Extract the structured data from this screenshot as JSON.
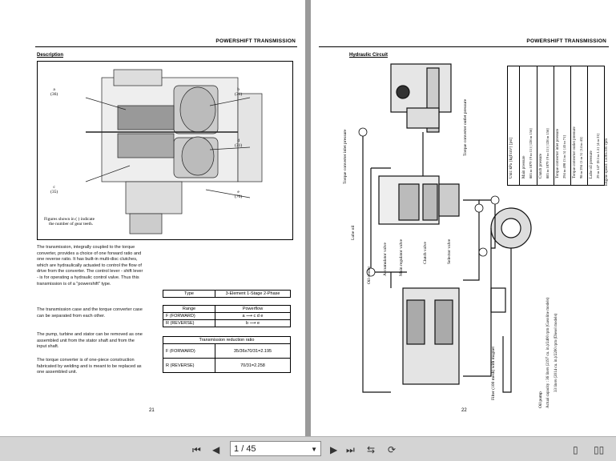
{
  "viewer": {
    "pagination": {
      "current": "1",
      "separator": "/",
      "total": "45"
    }
  },
  "left_page": {
    "header": "POWERSHIFT TRANSMISSION",
    "section": "Description",
    "callouts": [
      {
        "letter": "a",
        "teeth": "(36)"
      },
      {
        "letter": "b",
        "teeth": "(31)"
      },
      {
        "letter": "d",
        "teeth": "(31)"
      },
      {
        "letter": "c",
        "teeth": "(35)"
      },
      {
        "letter": "e",
        "teeth": "(70)"
      }
    ],
    "figure_note_1": "Figures shown in ( ) indicate",
    "figure_note_2": "the number of gear teeth.",
    "paragraphs": [
      " The transmission, integrally coupled to the torque converter, provides a choice of one forward ratio and one reverse ratio. It has built-in multi-disc clutches, which are hydraulically actuated to control the flow of drive from the converter. The control lever - shift lever - is for operating a hydraulic control valve. Thus this transmission is of a \"powershift\" type.",
      " The transmission case and the torque converter case can be separated from each other.",
      " The pump, turbine and stator can be removed as one assembled unit from the stator shaft and from the input shaft.",
      " The torque converter is of one-piece construction fabricated by welding and is meant to be replaced as one assembled unit."
    ],
    "type_table": {
      "label": "Type",
      "value": "3-Element 1-Stage 2-Phase"
    },
    "range_table": {
      "headers": [
        "Range",
        "Powerflow"
      ],
      "rows": [
        {
          "range": "F (FORWARD)",
          "flow": "a ⟶ c d e"
        },
        {
          "range": "R (REVERSE)",
          "flow": "b ⟶ e"
        }
      ]
    },
    "ratio_table": {
      "header": "Transmission reduction ratio",
      "rows": [
        {
          "range": "F (FORWARD)",
          "ratio": "35/36x70/31=2.195"
        },
        {
          "range": "R (REVERSE)",
          "ratio": "70/31=2.258"
        }
      ]
    },
    "page_number": "21"
  },
  "right_page": {
    "header": "POWERSHIFT TRANSMISSION",
    "section": "Hydraulic Circuit",
    "labels": [
      "Torque converter inlet pressure",
      "Torque converter outlet pressure",
      "Lube oil",
      "Oil cooler",
      "Accumulator valve",
      "Main regulator valve",
      "Clutch valve",
      "Selector valve",
      "Filter (100 mesh) with magnet",
      "Oil pump",
      "Actual capacity : 36 liters (2197 cu. in.)/2400 rpm (Gasoline models)",
      "33 liters (2014 cu. in.)/2200 rpm (Diesel models)"
    ],
    "pressure_table": {
      "unit": "Unit: kPa {kgf/cm²} [psi]",
      "rows": [
        {
          "id": "a",
          "name": "Main pressure",
          "value": "883 to 1079 {9 to 11} [128 to 156]"
        },
        {
          "id": "b",
          "name": "Clutch pressure",
          "value": "883 to 1079 {9 to 11} [128 to 156]"
        },
        {
          "id": "c",
          "name": "Torque converter inlet pressure",
          "value": "294 to 490 {3 to 5} [43 to 71]"
        },
        {
          "id": "d",
          "name": "Torque converter outlet pressure",
          "value": "98 to 294 {1 to 3} [14 to 43]"
        },
        {
          "id": "e",
          "name": "Lube oil pressure",
          "value": "29 to 147 {0.3 to 1.5} [4 to 21]"
        }
      ],
      "footnote": "Engine speed: 1500±100 rpm"
    },
    "page_number": "22"
  }
}
